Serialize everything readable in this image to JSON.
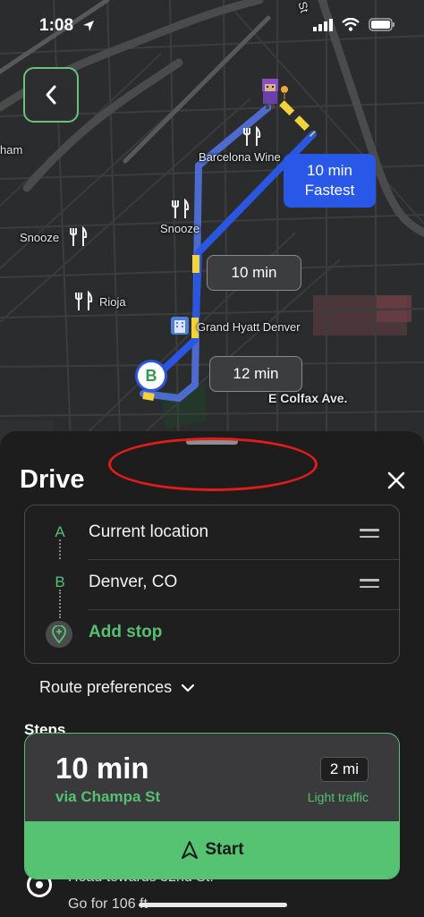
{
  "status": {
    "time": "1:08",
    "icons": [
      "location-arrow-icon",
      "cell-signal-icon",
      "wifi-icon",
      "battery-icon"
    ]
  },
  "map": {
    "labels": {
      "ham": "ham",
      "snooze_left": "Snooze",
      "snooze_center": "Snooze",
      "barcelona": "Barcelona Wine",
      "rioja": "Rioja",
      "hyatt": "Grand Hyatt Denver",
      "colfax": "E Colfax Ave.",
      "street_top": "St"
    },
    "bubbles": {
      "fastest_time": "10 min",
      "fastest_tag": "Fastest",
      "alt1": "10 min",
      "alt2": "12 min"
    },
    "marker_b": "B",
    "colors": {
      "route_primary": "#2a56e0",
      "route_alt": "#4f6fd6",
      "traffic": "#f2d33b",
      "accent": "#56c173"
    }
  },
  "sheet": {
    "title": "Drive",
    "stops": [
      {
        "letter": "A",
        "label": "Current location"
      },
      {
        "letter": "B",
        "label": "Denver, CO"
      }
    ],
    "add_stop": "Add stop",
    "route_preferences": "Route preferences",
    "steps_label": "Steps",
    "route": {
      "time": "10 min",
      "via": "via Champa St",
      "distance": "2 mi",
      "traffic": "Light traffic",
      "start": "Start"
    },
    "step": {
      "heading": "Head towards 32nd St.",
      "distance": "Go for 106 ft"
    }
  }
}
